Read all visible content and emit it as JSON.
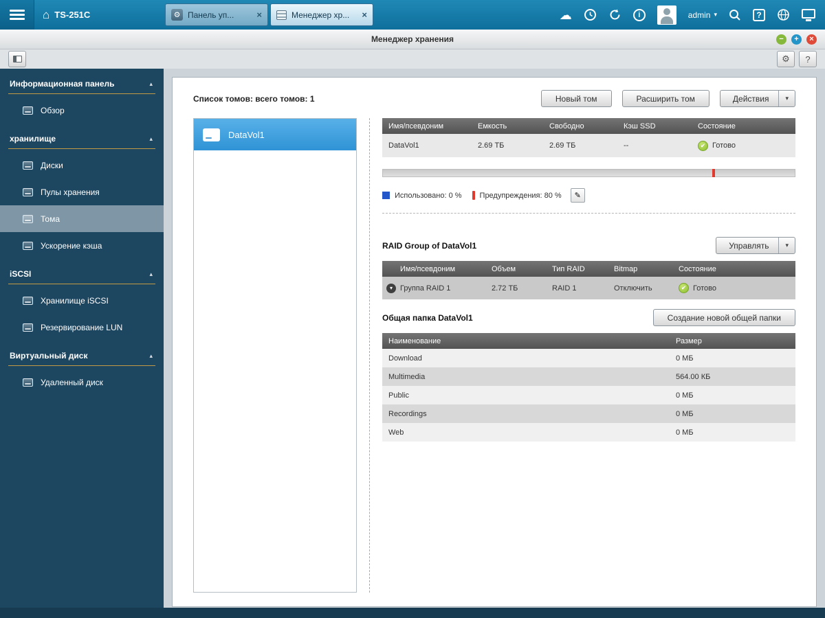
{
  "colors": {
    "topbar_blue": "#1479a6",
    "sidebar_navy": "#1d4660",
    "accent_gold": "#c59a45",
    "selected_blue": "#3399dd",
    "ok_green": "#8cbf2f",
    "warn_red": "#e0392e",
    "used_blue": "#2456c9"
  },
  "icons": {
    "home": "⌂",
    "gear": "⚙",
    "close": "×",
    "cloud": "☁",
    "info": "i",
    "question": "?",
    "caret_up": "▴",
    "caret_down": "▾",
    "check": "✔",
    "pencil": "✎",
    "minus": "−",
    "plus": "+"
  },
  "topbar": {
    "device_name": "TS-251C",
    "tabs": [
      {
        "label": "Панель уп..."
      },
      {
        "label": "Менеджер хр..."
      }
    ],
    "user_label": "admin"
  },
  "window": {
    "title": "Менеджер хранения"
  },
  "sidebar": {
    "sections": [
      {
        "label": "Информационная панель",
        "items": [
          {
            "label": "Обзор"
          }
        ]
      },
      {
        "label": "хранилище",
        "items": [
          {
            "label": "Диски"
          },
          {
            "label": "Пулы хранения"
          },
          {
            "label": "Тома"
          },
          {
            "label": "Ускорение кэша"
          }
        ]
      },
      {
        "label": "iSCSI",
        "items": [
          {
            "label": "Хранилище iSCSI"
          },
          {
            "label": "Резервирование LUN"
          }
        ]
      },
      {
        "label": "Виртуальный диск",
        "items": [
          {
            "label": "Удаленный диск"
          }
        ]
      }
    ]
  },
  "content": {
    "list_header": "Список томов: всего томов: 1",
    "toolbar_buttons": {
      "new_volume": "Новый том",
      "expand_volume": "Расширить том",
      "actions": "Действия"
    },
    "volume_list": {
      "items": [
        {
          "name": "DataVol1"
        }
      ]
    },
    "volume_table": {
      "headers": [
        "Имя/псевдоним",
        "Емкость",
        "Свободно",
        "Кэш SSD",
        "Состояние"
      ],
      "row": {
        "name": "DataVol1",
        "capacity": "2.69 ТБ",
        "free": "2.69 ТБ",
        "cache": "--",
        "status": "Готово"
      }
    },
    "usage": {
      "used_label": "Использовано: 0 %",
      "warning_label": "Предупреждения: 80 %",
      "warning_percent": 80
    },
    "raid": {
      "title": "RAID Group of DataVol1",
      "manage_button": "Управлять",
      "headers": [
        "Имя/псевдоним",
        "Объем",
        "Тип RAID",
        "Bitmap",
        "Состояние"
      ],
      "row": {
        "name": "Группа RAID 1",
        "size": "2.72 ТБ",
        "type": "RAID 1",
        "bitmap": "Отключить",
        "status": "Готово"
      }
    },
    "shares": {
      "title": "Общая папка DataVol1",
      "create_button": "Создание новой общей папки",
      "headers": [
        "Наименование",
        "Размер"
      ],
      "rows": [
        {
          "name": "Download",
          "size": "0 МБ"
        },
        {
          "name": "Multimedia",
          "size": "564.00 КБ"
        },
        {
          "name": "Public",
          "size": "0 МБ"
        },
        {
          "name": "Recordings",
          "size": "0 МБ"
        },
        {
          "name": "Web",
          "size": "0 МБ"
        }
      ]
    }
  }
}
